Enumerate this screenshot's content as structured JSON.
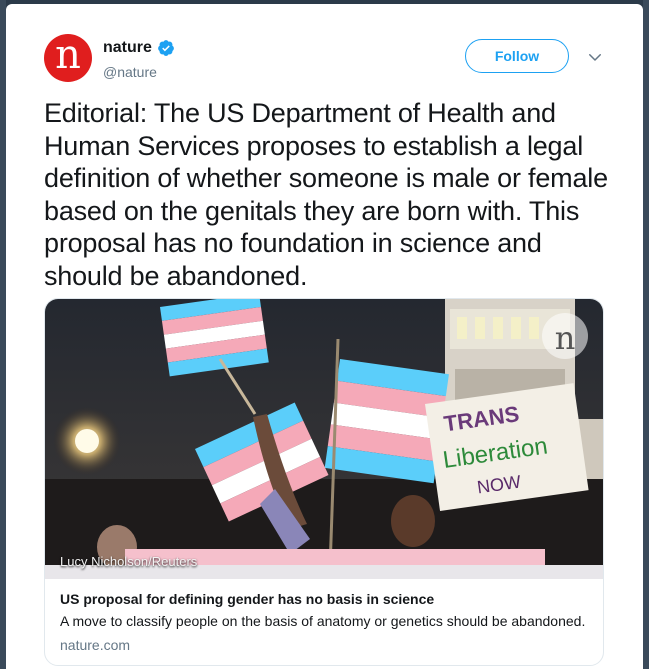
{
  "tweet": {
    "display_name": "nature",
    "handle": "@nature",
    "avatar_letter": "n",
    "follow_label": "Follow",
    "text": "Editorial: The US Department of Health and Human Services proposes to establish a legal definition of whether someone is male or female based on the genitals they are born with. This proposal has no foundation in science and should be abandoned."
  },
  "card": {
    "photo_credit": "Lucy Nicholson/Reuters",
    "sign_line1": "TRANS",
    "sign_line2": "Liberation",
    "sign_line3": "NOW",
    "title": "US proposal for defining gender has no basis in science",
    "description": "A move to classify people on the basis of anatomy or genetics should be abandoned.",
    "domain": "nature.com",
    "watermark_letter": "n"
  },
  "colors": {
    "brand_red": "#e01e1e",
    "twitter_blue": "#1da1f2",
    "text_dark": "#14171a",
    "text_gray": "#657786",
    "flag_pink": "#f5a9b8",
    "flag_blue": "#5bcefa"
  },
  "icons": {
    "verified": "verified-badge-icon",
    "caret": "chevron-down-icon"
  }
}
